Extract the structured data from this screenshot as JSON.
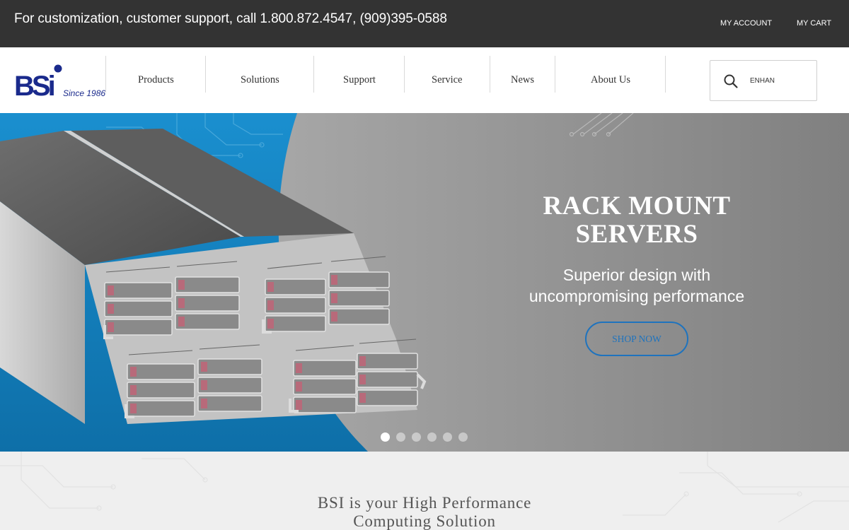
{
  "topbar": {
    "support_text": "For customization, customer support, call 1.800.872.4547, (909)395-0588",
    "my_account": "MY ACCOUNT",
    "my_cart": "MY CART"
  },
  "header": {
    "logo": {
      "text": "BSi",
      "tagline": "Since 1986"
    },
    "nav": {
      "products": "Products",
      "solutions": "Solutions",
      "support": "Support",
      "service": "Service",
      "news": "News",
      "about": "About Us"
    },
    "search": {
      "value": "ENHAN",
      "icon": "search-icon"
    }
  },
  "hero": {
    "title_line1": "RACK MOUNT",
    "title_line2": "SERVERS",
    "subtitle_line1": "Superior design with",
    "subtitle_line2": "uncompromising performance",
    "cta": "SHOP NOW",
    "slide_count": 6,
    "active_slide": 1
  },
  "intro": {
    "title_line1": "BSI is your High Performance",
    "title_line2": "Computing Solution"
  },
  "colors": {
    "topbar_bg": "#333333",
    "brand_blue": "#1a2a8c",
    "accent_blue": "#1e73be",
    "hero_blue": "#1480bf"
  }
}
